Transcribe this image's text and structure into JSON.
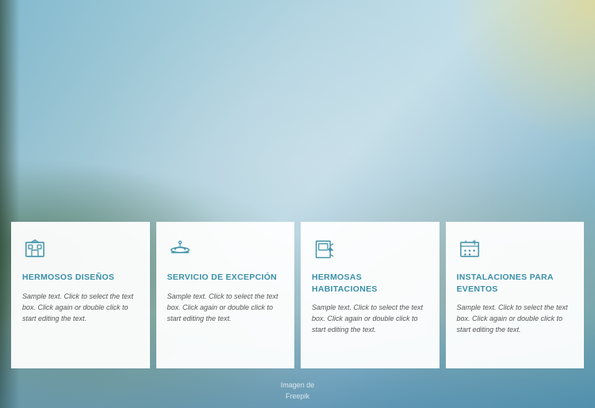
{
  "background": {
    "credit_line1": "Imagen de",
    "credit_line2": "Freepik"
  },
  "cards": [
    {
      "id": "card-1",
      "icon": "hotel-icon",
      "title": "HERMOSOS DISEÑOS",
      "text": "Sample text. Click to select the text box. Click again or double click to start editing the text."
    },
    {
      "id": "card-2",
      "icon": "service-icon",
      "title": "SERVICIO DE EXCEPCIÓN",
      "text": "Sample text. Click to select the text box. Click again or double click to start editing the text."
    },
    {
      "id": "card-3",
      "icon": "room-icon",
      "title": "HERMOSAS HABITACIONES",
      "text": "Sample text. Click to select the text box. Click again or double click to start editing the text."
    },
    {
      "id": "card-4",
      "icon": "events-icon",
      "title": "INSTALACIONES PARA EVENTOS",
      "text": "Sample text. Click to select the text box. Click again or double click to start editing the text."
    }
  ]
}
